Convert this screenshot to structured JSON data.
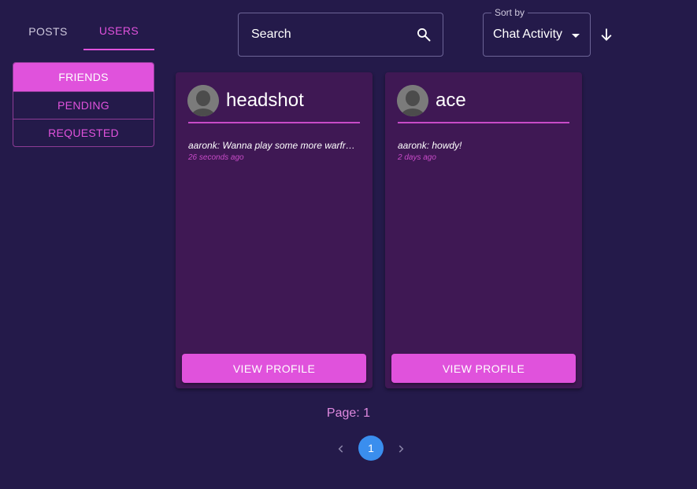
{
  "tabs": [
    {
      "label": "POSTS",
      "active": false
    },
    {
      "label": "USERS",
      "active": true
    }
  ],
  "filters": [
    {
      "label": "FRIENDS",
      "selected": true
    },
    {
      "label": "PENDING",
      "selected": false
    },
    {
      "label": "REQUESTED",
      "selected": false
    }
  ],
  "search": {
    "placeholder": "Search",
    "icon": "search-icon"
  },
  "sort": {
    "label": "Sort by",
    "value": "Chat Activity",
    "direction_icon": "arrow-down-icon"
  },
  "cards": [
    {
      "name": "headshot",
      "message": "aaronk: Wanna play some more warframe?",
      "time": "26 seconds ago",
      "button": "VIEW PROFILE"
    },
    {
      "name": "ace",
      "message": "aaronk: howdy!",
      "time": "2 days ago",
      "button": "VIEW PROFILE"
    }
  ],
  "pagination": {
    "label": "Page: 1",
    "current": "1"
  },
  "colors": {
    "background": "#241a4a",
    "accent": "#e052dc",
    "card": "#3f1854",
    "page_active": "#3a8eee"
  }
}
